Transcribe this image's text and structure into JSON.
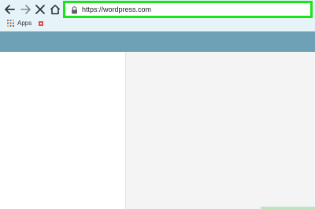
{
  "browser": {
    "address_bar": {
      "url": "https://wordpress.com"
    },
    "bookmarks_bar": {
      "apps_label": "Apps"
    }
  },
  "colors": {
    "toolbar_bg": "#e6f4fa",
    "highlight_border": "#19e619",
    "site_header": "#6fa1b6",
    "site_content": "#f4f4f4"
  },
  "icons": {
    "back": "arrow-left-icon",
    "forward": "arrow-right-icon",
    "stop": "close-icon",
    "home": "home-icon",
    "lock": "lock-icon",
    "apps": "apps-grid-icon",
    "bookmark": "bookmark-favicon"
  }
}
